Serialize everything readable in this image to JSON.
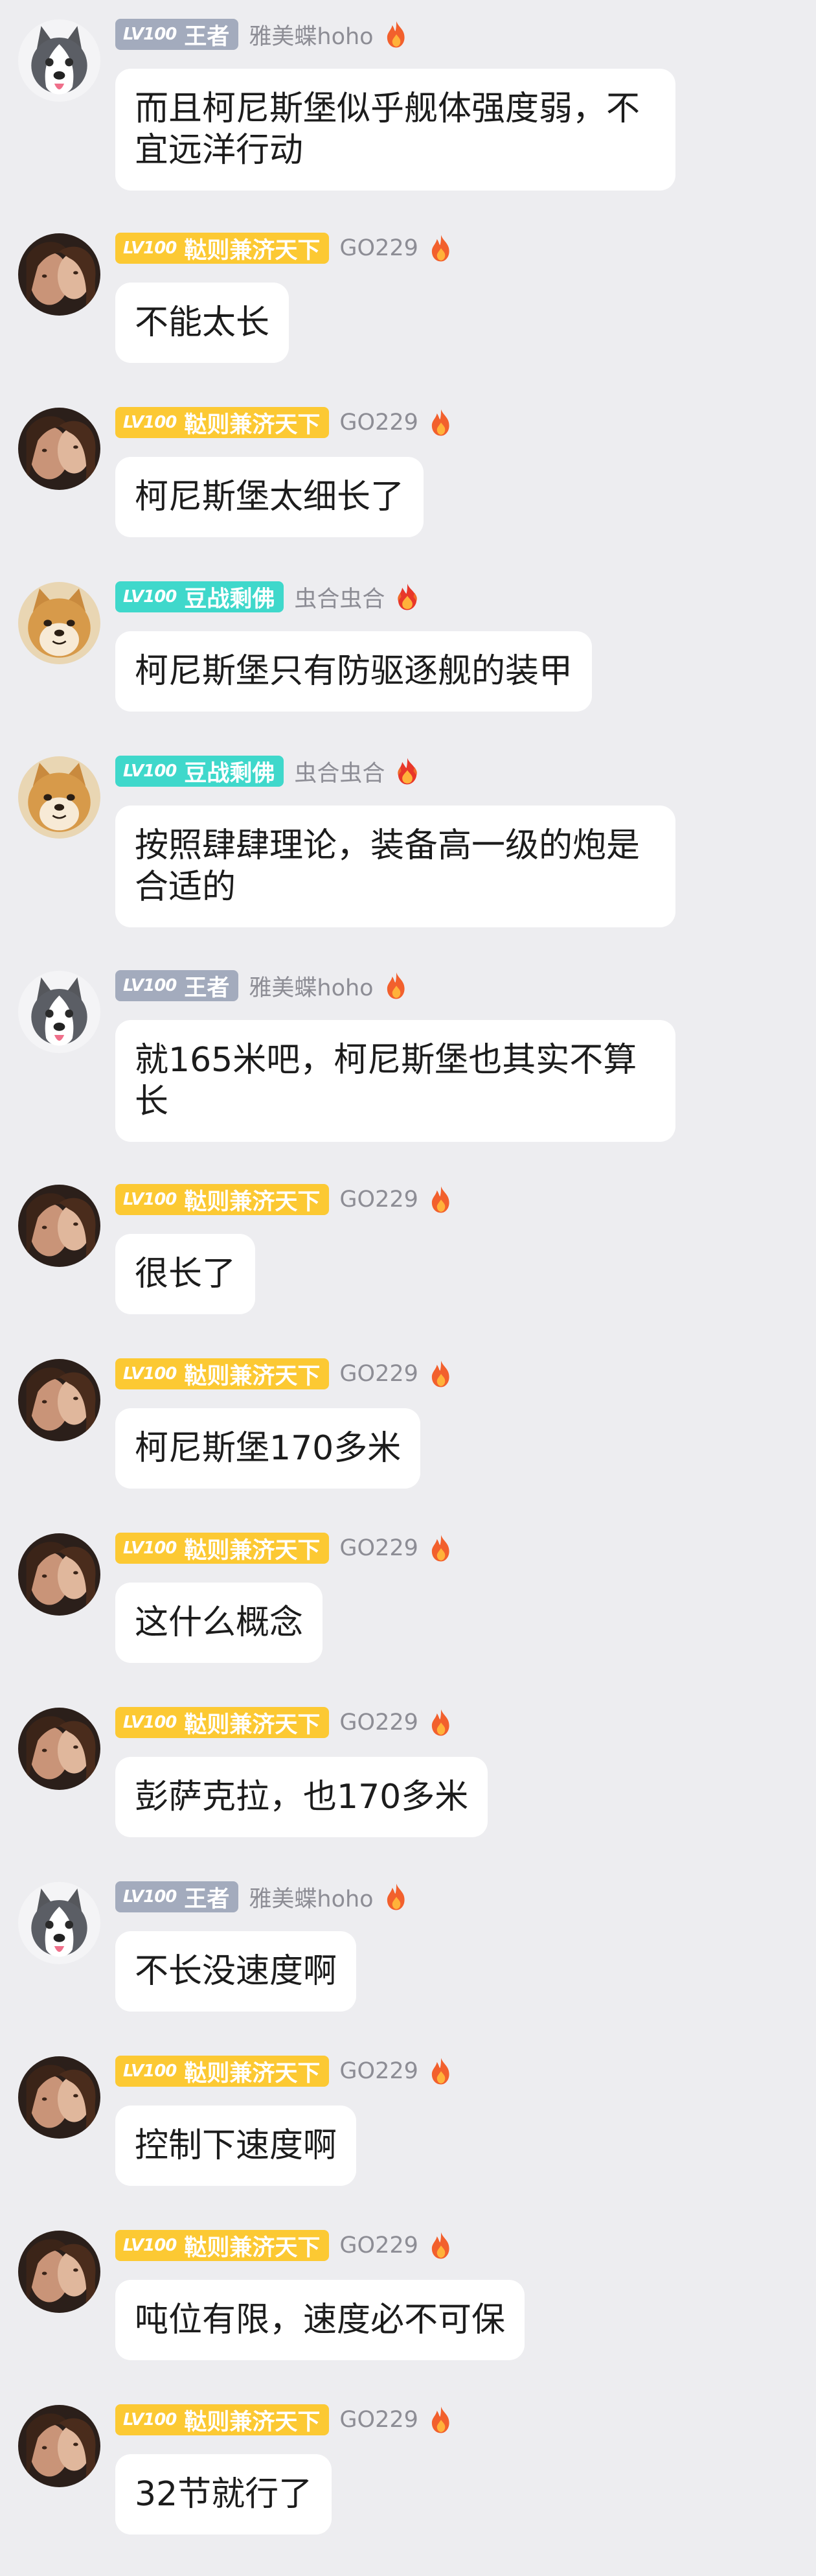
{
  "messages": [
    {
      "level": "LV100",
      "title": "王者",
      "nick": "雅美蝶hoho",
      "badge": "silver",
      "avatar": "husky",
      "flame": "orange",
      "text": "而且柯尼斯堡似乎舰体强度弱，不宜远洋行动"
    },
    {
      "level": "LV100",
      "title": "鞑则兼济天下",
      "nick": "GO229",
      "badge": "gold",
      "avatar": "couple",
      "flame": "orange",
      "text": "不能太长"
    },
    {
      "level": "LV100",
      "title": "鞑则兼济天下",
      "nick": "GO229",
      "badge": "gold",
      "avatar": "couple",
      "flame": "orange",
      "text": "柯尼斯堡太细长了"
    },
    {
      "level": "LV100",
      "title": "豆战剩佛",
      "nick": "虫合虫合",
      "badge": "teal",
      "avatar": "shiba",
      "flame": "red",
      "text": "柯尼斯堡只有防驱逐舰的装甲"
    },
    {
      "level": "LV100",
      "title": "豆战剩佛",
      "nick": "虫合虫合",
      "badge": "teal",
      "avatar": "shiba",
      "flame": "red",
      "text": "按照肆肆理论，装备高一级的炮是合适的"
    },
    {
      "level": "LV100",
      "title": "王者",
      "nick": "雅美蝶hoho",
      "badge": "silver",
      "avatar": "husky",
      "flame": "orange",
      "text": "就165米吧，柯尼斯堡也其实不算长"
    },
    {
      "level": "LV100",
      "title": "鞑则兼济天下",
      "nick": "GO229",
      "badge": "gold",
      "avatar": "couple",
      "flame": "orange",
      "text": "很长了"
    },
    {
      "level": "LV100",
      "title": "鞑则兼济天下",
      "nick": "GO229",
      "badge": "gold",
      "avatar": "couple",
      "flame": "orange",
      "text": "柯尼斯堡170多米"
    },
    {
      "level": "LV100",
      "title": "鞑则兼济天下",
      "nick": "GO229",
      "badge": "gold",
      "avatar": "couple",
      "flame": "orange",
      "text": "这什么概念"
    },
    {
      "level": "LV100",
      "title": "鞑则兼济天下",
      "nick": "GO229",
      "badge": "gold",
      "avatar": "couple",
      "flame": "orange",
      "text": "彭萨克拉，也170多米"
    },
    {
      "level": "LV100",
      "title": "王者",
      "nick": "雅美蝶hoho",
      "badge": "silver",
      "avatar": "husky",
      "flame": "orange",
      "text": "不长没速度啊"
    },
    {
      "level": "LV100",
      "title": "鞑则兼济天下",
      "nick": "GO229",
      "badge": "gold",
      "avatar": "couple",
      "flame": "orange",
      "text": "控制下速度啊"
    },
    {
      "level": "LV100",
      "title": "鞑则兼济天下",
      "nick": "GO229",
      "badge": "gold",
      "avatar": "couple",
      "flame": "orange",
      "text": "吨位有限，速度必不可保"
    },
    {
      "level": "LV100",
      "title": "鞑则兼济天下",
      "nick": "GO229",
      "badge": "gold",
      "avatar": "couple",
      "flame": "orange",
      "text": "32节就行了"
    }
  ],
  "colors": {
    "background": "#ededf0",
    "bubble": "#ffffff",
    "badge_silver": "#a3abbd",
    "badge_gold": "#fcc933",
    "badge_teal": "#3fd8cb",
    "nick": "#8d8d95"
  }
}
